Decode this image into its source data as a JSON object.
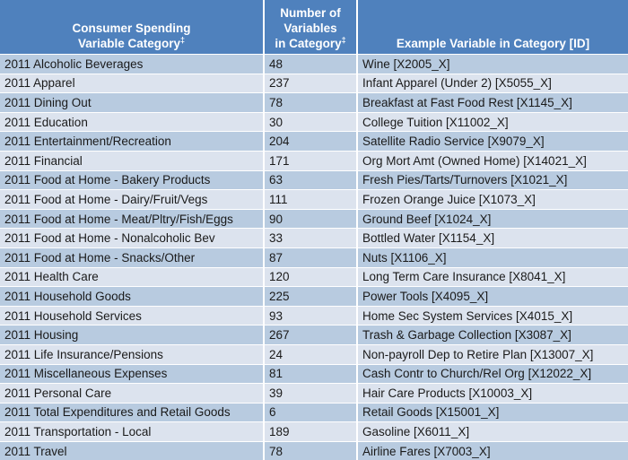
{
  "table": {
    "headers": {
      "category": {
        "line1": "Consumer Spending",
        "line2": "Variable Category",
        "marker": "‡"
      },
      "count": {
        "line1": "Number of",
        "line2": "Variables",
        "line3": "in Category",
        "marker": "‡"
      },
      "example": {
        "line1": "Example Variable in Category [ID]"
      }
    },
    "colors": {
      "header_background": "#4F81BD",
      "header_text": "#FFFFFF",
      "row_band_dark": "#B8CBE0",
      "row_band_light": "#DCE3EE",
      "gridline": "#FFFFFF",
      "body_text": "#1A1A1A"
    },
    "rows": [
      {
        "category": "2011 Alcoholic Beverages",
        "count": "48",
        "example": "Wine [X2005_X]"
      },
      {
        "category": "2011 Apparel",
        "count": "237",
        "example": "Infant Apparel (Under 2) [X5055_X]"
      },
      {
        "category": "2011 Dining Out",
        "count": "78",
        "example": "Breakfast at Fast Food Rest [X1145_X]"
      },
      {
        "category": "2011 Education",
        "count": "30",
        "example": "College Tuition [X11002_X]"
      },
      {
        "category": "2011 Entertainment/Recreation",
        "count": "204",
        "example": "Satellite Radio Service [X9079_X]"
      },
      {
        "category": "2011 Financial",
        "count": "171",
        "example": "Org Mort Amt (Owned Home) [X14021_X]"
      },
      {
        "category": "2011 Food at Home - Bakery Products",
        "count": "63",
        "example": "Fresh Pies/Tarts/Turnovers [X1021_X]"
      },
      {
        "category": "2011 Food at Home - Dairy/Fruit/Vegs",
        "count": "111",
        "example": "Frozen Orange Juice [X1073_X]"
      },
      {
        "category": "2011 Food at Home - Meat/Pltry/Fish/Eggs",
        "count": "90",
        "example": "Ground Beef [X1024_X]"
      },
      {
        "category": "2011 Food at Home - Nonalcoholic Bev",
        "count": "33",
        "example": "Bottled Water [X1154_X]"
      },
      {
        "category": "2011 Food at Home - Snacks/Other",
        "count": "87",
        "example": "Nuts [X1106_X]"
      },
      {
        "category": "2011 Health Care",
        "count": "120",
        "example": "Long Term Care Insurance [X8041_X]"
      },
      {
        "category": "2011 Household Goods",
        "count": "225",
        "example": "Power Tools [X4095_X]"
      },
      {
        "category": "2011 Household Services",
        "count": "93",
        "example": "Home Sec System Services [X4015_X]"
      },
      {
        "category": "2011 Housing",
        "count": "267",
        "example": "Trash & Garbage Collection [X3087_X]"
      },
      {
        "category": "2011 Life Insurance/Pensions",
        "count": "24",
        "example": "Non-payroll Dep to Retire Plan [X13007_X]"
      },
      {
        "category": "2011 Miscellaneous Expenses",
        "count": "81",
        "example": "Cash Contr to Church/Rel Org [X12022_X]"
      },
      {
        "category": "2011 Personal Care",
        "count": "39",
        "example": "Hair Care Products [X10003_X]"
      },
      {
        "category": "2011 Total Expenditures and Retail Goods",
        "count": "6",
        "example": "Retail Goods [X15001_X]"
      },
      {
        "category": "2011 Transportation - Local",
        "count": "189",
        "example": "Gasoline [X6011_X]"
      },
      {
        "category": "2011 Travel",
        "count": "78",
        "example": "Airline Fares [X7003_X]"
      }
    ]
  }
}
